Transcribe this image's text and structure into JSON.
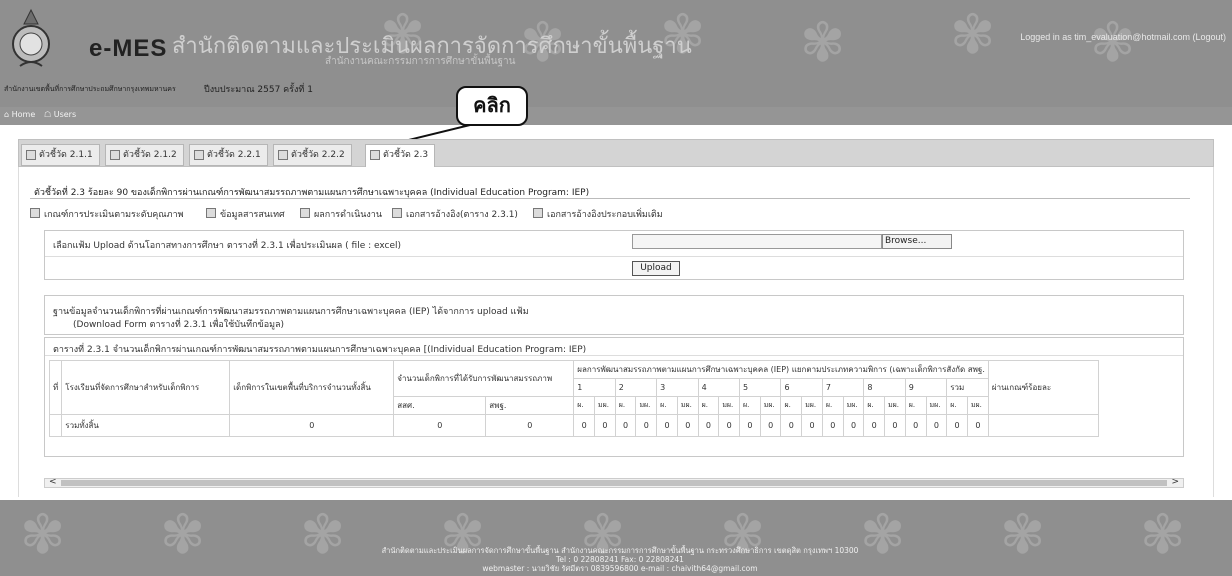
{
  "header": {
    "app_name": "e-MES",
    "org_title": "สำนักติดตามและประเมินผลการจัดการศึกษาขั้นพื้นฐาน",
    "org_subtitle": "สำนักงานคณะกรรมการการศึกษาขั้นพื้นฐาน",
    "office_name": "สำนักงานเขตพื้นที่การศึกษาประถมศึกษากรุงเทพมหานคร",
    "budget_year": "ปีงบประมาณ 2557 ครั้งที่ 1",
    "logged_in_text": "Logged in as tim_evaluation@hotmail.com",
    "logout_label": "(Logout)"
  },
  "nav": {
    "home_label": "Home",
    "users_label": "Users"
  },
  "callout": {
    "text": "คลิก"
  },
  "tabs": [
    {
      "label": "ตัวชี้วัด 2.1.1",
      "active": false
    },
    {
      "label": "ตัวชี้วัด 2.1.2",
      "active": false
    },
    {
      "label": "ตัวชี้วัด 2.2.1",
      "active": false
    },
    {
      "label": "ตัวชี้วัด 2.2.2",
      "active": false
    },
    {
      "label": "ตัวชี้วัด 2.3",
      "active": true
    }
  ],
  "indicator_title": "ตัวชี้วัดที่ 2.3 ร้อยละ 90 ของเด็กพิการผ่านเกณฑ์การพัฒนาสมรรถภาพตามแผนการศึกษาเฉพาะบุคคล (Individual Education Program: IEP)",
  "subtabs": [
    {
      "label": "เกณฑ์การประเมินตามระดับคุณภาพ"
    },
    {
      "label": "ข้อมูลสารสนเทศ"
    },
    {
      "label": "ผลการดำเนินงาน"
    },
    {
      "label": "เอกสารอ้างอิง(ตาราง 2.3.1)"
    },
    {
      "label": "เอกสารอ้างอิงประกอบเพิ่มเติม"
    }
  ],
  "upload": {
    "label": "เลือกแฟ้ม Upload ด้านโอกาสทางการศึกษา ตารางที่ 2.3.1 เพื่อประเมินผล ( file : excel)",
    "file_value": "",
    "browse_label": "Browse...",
    "upload_label": "Upload"
  },
  "info": {
    "line1": "ฐานข้อมูลจำนวนเด็กพิการที่ผ่านเกณฑ์การพัฒนาสมรรถภาพตามแผนการศึกษาเฉพาะบุคคล (IEP) ได้จากการ upload แฟ้ม",
    "line2": "(Download Form ตารางที่ 2.3.1 เพื่อใช้บันทึกข้อมูล)"
  },
  "table": {
    "caption": "ตารางที่ 2.3.1 จำนวนเด็กพิการผ่านเกณฑ์การพัฒนาสมรรถภาพตามแผนการศึกษาเฉพาะบุคคล [(Individual Education Program: IEP)",
    "headers": {
      "no": "ที่",
      "school": "โรงเรียนที่จัดการศึกษาสำหรับเด็กพิการ",
      "in_area": "เด็กพิการในเขตพื้นที่บริการจำนวนทั้งสิ้น",
      "received": "จำนวนเด็กพิการที่ได้รับการพัฒนาสมรรถภาพ",
      "iep_group": "ผลการพัฒนาสมรรถภาพตามแผนการศึกษาเฉพาะบุคคล (IEP) แยกตามประเภทความพิการ (เฉพาะเด็กพิการสังกัด สพฐ.",
      "pass_percent": "ผ่านเกณฑ์ร้อยละ",
      "sub_a": "สสศ.",
      "sub_b": "สพฐ.",
      "categories": [
        "1",
        "2",
        "3",
        "4",
        "5",
        "6",
        "7",
        "8",
        "9",
        "รวม"
      ],
      "pass_label": "ผ.",
      "fail_label": "มผ."
    },
    "total_row": {
      "label": "รวมทั้งสิ้น",
      "in_area": "0",
      "sub_a": "0",
      "sub_b": "0",
      "cells": [
        "0",
        "0",
        "0",
        "0",
        "0",
        "0",
        "0",
        "0",
        "0",
        "0",
        "0",
        "0",
        "0",
        "0",
        "0",
        "0",
        "0",
        "0",
        "0",
        "0"
      ],
      "pass_percent": ""
    }
  },
  "footer": {
    "line1": "สำนักติดตามและประเมินผลการจัดการศึกษาขั้นพื้นฐาน สำนักงานคณะกรรมการการศึกษาขั้นพื้นฐาน กระทรวงศึกษาธิการ เขตดุสิต กรุงเทพฯ 10300",
    "line2": "Tel : 0 22808241 Fax: 0 22808241",
    "line3": "webmaster : นายวิชัย รัศมีตรา 0839596800 e-mail : chaivith64@gmail.com"
  },
  "colors": {
    "header_bg": "#8f8f8f",
    "tab_bar_bg": "#d4d4d4",
    "footer_bg": "#8f8f8f"
  }
}
